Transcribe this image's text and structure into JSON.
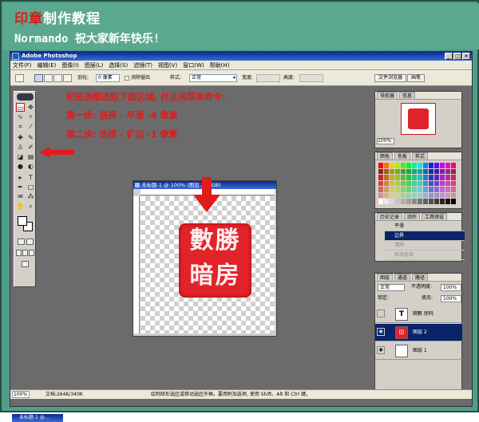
{
  "banner": {
    "title_red": "印章",
    "title_rest": "制作教程",
    "subtitle": "Normando 祝大家新年快乐!"
  },
  "window": {
    "title": "Adobe Photoshop",
    "controls": [
      "_",
      "□",
      "×"
    ]
  },
  "menubar": {
    "items": [
      "文件(F)",
      "编辑(E)",
      "图像(I)",
      "图层(L)",
      "选择(S)",
      "滤镜(T)",
      "视图(V)",
      "窗口(W)",
      "帮助(H)"
    ]
  },
  "options": {
    "feather_label": "羽化:",
    "feather_value": "0 像素",
    "antialias_label": "消除锯齿",
    "style_label": "样式:",
    "style_value": "正常",
    "width_label": "宽度:",
    "height_label": "高度:",
    "wells": [
      "文件浏览器",
      "画笔"
    ]
  },
  "annotations": {
    "line1": "矩形选框选取下面区域, 并且用菜单命令:",
    "line2": "第一步: 选择 - 平滑 -4 像素",
    "line3": "第二步: 选择 - 扩边 -1 像素"
  },
  "document": {
    "title": "未标题-1 @ 100% (图层 2, RGB)",
    "seal_chars": "數勝暗房"
  },
  "taskbar": {
    "label": "未标题-1 @..."
  },
  "statusbar": {
    "zoom": "100%",
    "doc_size": "文档:264K/340K",
    "hint": "绘制矩形选区或移动选区外框。要用附加选项, 使用 Shift、Alt 和 Ctrl 键。"
  },
  "navigator": {
    "tabs": [
      "导航器",
      "信息"
    ],
    "zoom": "100%"
  },
  "color_panel": {
    "tabs": [
      "颜色",
      "色板",
      "样式"
    ]
  },
  "history": {
    "tabs": [
      "历史记录",
      "动作",
      "工具预设"
    ],
    "items": [
      "平滑",
      "边界",
      "清除",
      "取消选择"
    ],
    "active_index": 1
  },
  "layers": {
    "tabs": [
      "图层",
      "通道",
      "路径"
    ],
    "blend_mode": "正常",
    "opacity_label": "不透明度:",
    "opacity_value": "100%",
    "lock_label": "锁定:",
    "fill_label": "填充:",
    "fill_value": "100%",
    "rows": [
      {
        "name": "暗數 房码",
        "thumb": "T"
      },
      {
        "name": "图层 2",
        "thumb": "印"
      },
      {
        "name": "图层 1",
        "thumb": ""
      }
    ],
    "active_index": 1
  },
  "colors": {
    "accent_red": "#e21a1a",
    "seal_red": "#e0242a",
    "selection_blue": "#0a246a",
    "banner_green": "#5aa98f"
  }
}
